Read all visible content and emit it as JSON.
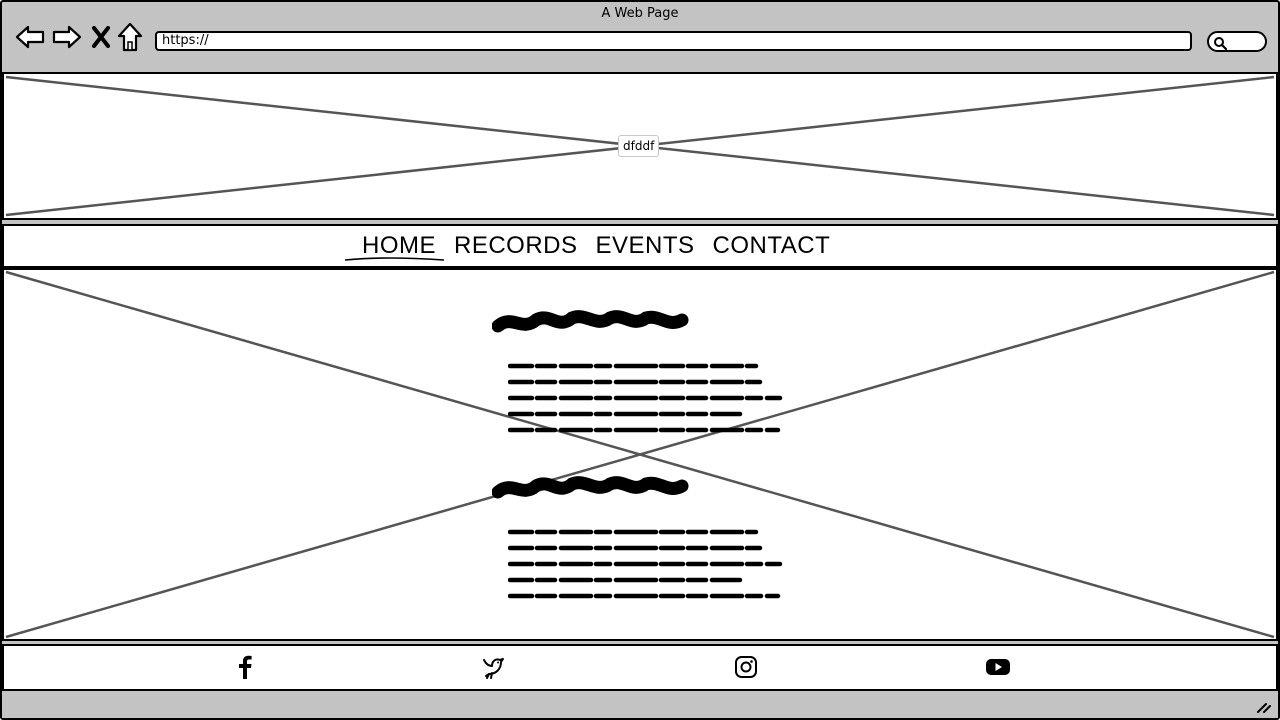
{
  "window": {
    "title": "A Web Page"
  },
  "toolbar": {
    "icons": [
      "back-arrow-icon",
      "forward-arrow-icon",
      "close-icon",
      "home-icon"
    ],
    "url_value": "https://",
    "search_icon": "search-icon"
  },
  "banner": {
    "label": "dfddf"
  },
  "nav": {
    "items": [
      {
        "label": "HOME",
        "active": true
      },
      {
        "label": "RECORDS",
        "active": false
      },
      {
        "label": "EVENTS",
        "active": false
      },
      {
        "label": "CONTACT",
        "active": false
      }
    ]
  },
  "footer": {
    "icons": [
      "facebook-icon",
      "twitter-bird-icon",
      "instagram-icon",
      "youtube-icon"
    ]
  },
  "colors": {
    "chrome": "#c3c3c3",
    "placeholder_line": "#555555",
    "ink": "#000000"
  }
}
